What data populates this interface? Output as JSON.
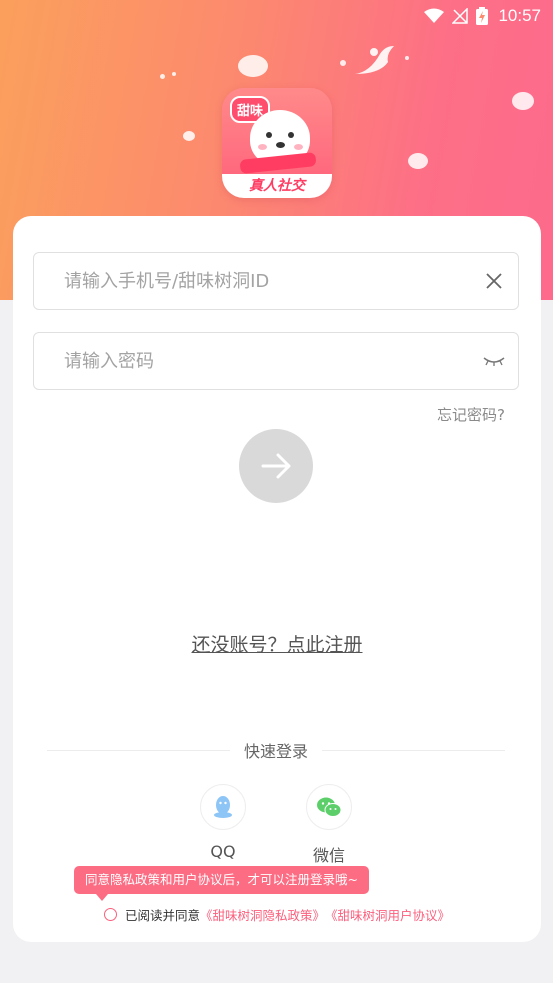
{
  "status_bar": {
    "time": "10:57"
  },
  "logo": {
    "tag": "甜味",
    "banner": "真人社交"
  },
  "login": {
    "account_placeholder": "请输入手机号/甜味树洞ID",
    "password_placeholder": "请输入密码",
    "forgot_password": "忘记密码?",
    "register_link": "还没账号？点此注册"
  },
  "quick_login": {
    "title": "快速登录",
    "options": [
      {
        "name": "QQ",
        "icon": "qq-icon",
        "color": "#8ec5f7"
      },
      {
        "name": "微信",
        "icon": "wechat-icon",
        "color": "#5ccf6a"
      }
    ]
  },
  "agreement": {
    "tooltip": "同意隐私政策和用户协议后，才可以注册登录哦~",
    "prefix": "已阅读并同意",
    "privacy_link": "《甜味树洞隐私政策》",
    "user_agreement_link": "《甜味树洞用户协议》"
  },
  "colors": {
    "accent": "#fc5f7d",
    "button_disabled": "#d9d9d9"
  }
}
